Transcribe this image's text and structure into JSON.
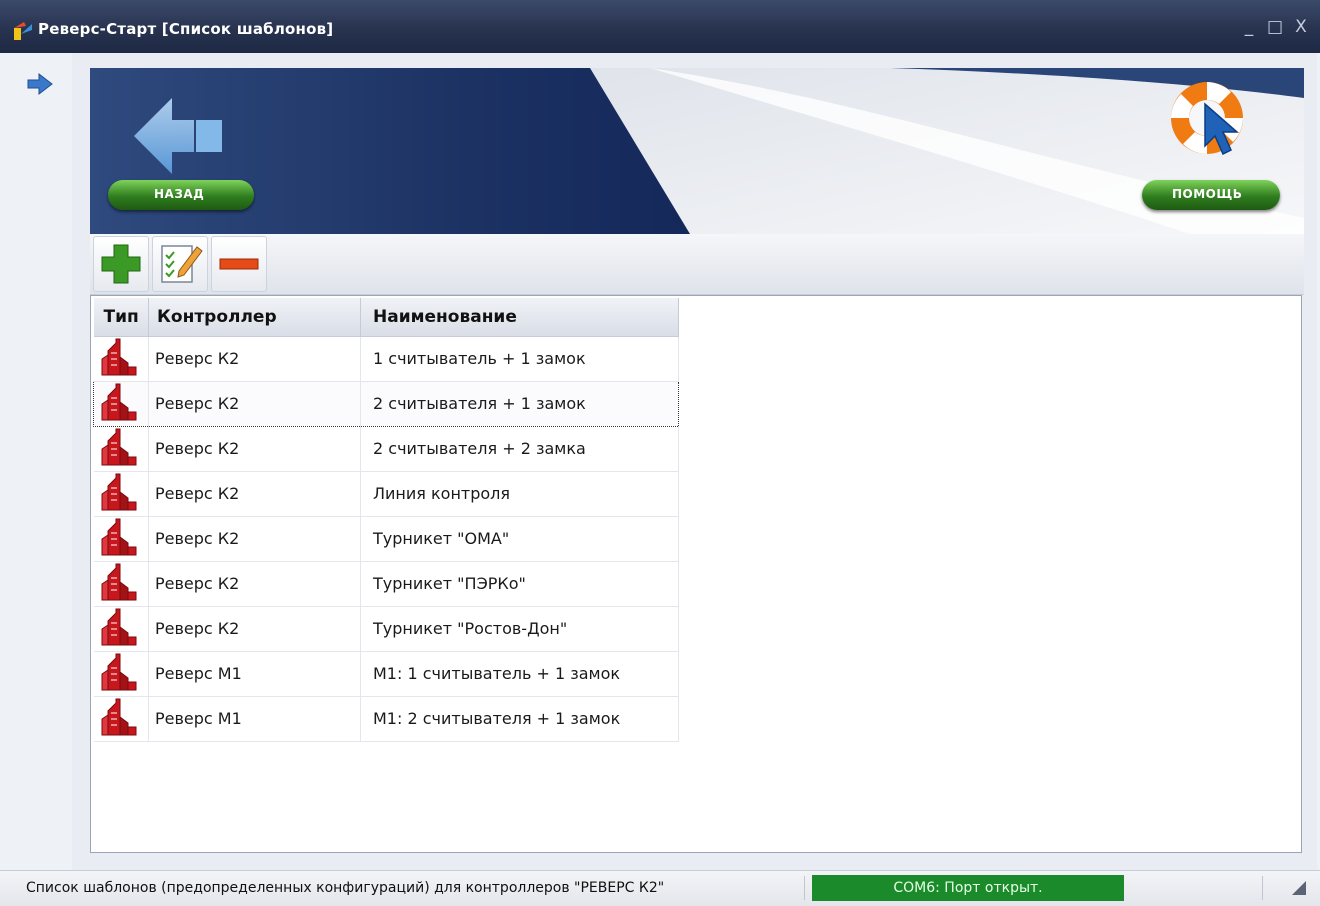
{
  "window": {
    "title": "Реверс-Старт  [Список шаблонов]",
    "minimize": "_",
    "maximize": "□",
    "close": "X"
  },
  "banner": {
    "back_label": "НАЗАД",
    "help_label": "ПОМОЩЬ"
  },
  "toolbar": {
    "add": "add-icon",
    "edit": "edit-icon",
    "remove": "remove-icon"
  },
  "table": {
    "columns": [
      "Тип",
      "Контроллер",
      "Наименование"
    ],
    "selected_index": 1,
    "rows": [
      {
        "controller": "Реверс К2",
        "name": "1 считыватель + 1 замок"
      },
      {
        "controller": "Реверс К2",
        "name": "2 считывателя + 1 замок"
      },
      {
        "controller": "Реверс К2",
        "name": "2 считывателя + 2 замка"
      },
      {
        "controller": "Реверс К2",
        "name": "Линия контроля"
      },
      {
        "controller": "Реверс К2",
        "name": "Турникет \"ОМА\""
      },
      {
        "controller": "Реверс К2",
        "name": "Турникет \"ПЭРКо\""
      },
      {
        "controller": "Реверс К2",
        "name": "Турникет \"Ростов-Дон\""
      },
      {
        "controller": "Реверс М1",
        "name": "М1: 1 считыватель + 1 замок"
      },
      {
        "controller": "Реверс М1",
        "name": "М1: 2 считывателя + 1 замок"
      }
    ]
  },
  "statusbar": {
    "message": "Список шаблонов (предопределенных конфигураций) для контроллеров \"РЕВЕРС К2\"",
    "port": "COM6: Порт открыт.",
    "port_color": "#1b8a2a"
  },
  "colors": {
    "title_bar": "#27334f",
    "banner_blue": "#1f3566",
    "button_green": "#2f7d1f",
    "type_icon_red": "#c8161d"
  }
}
